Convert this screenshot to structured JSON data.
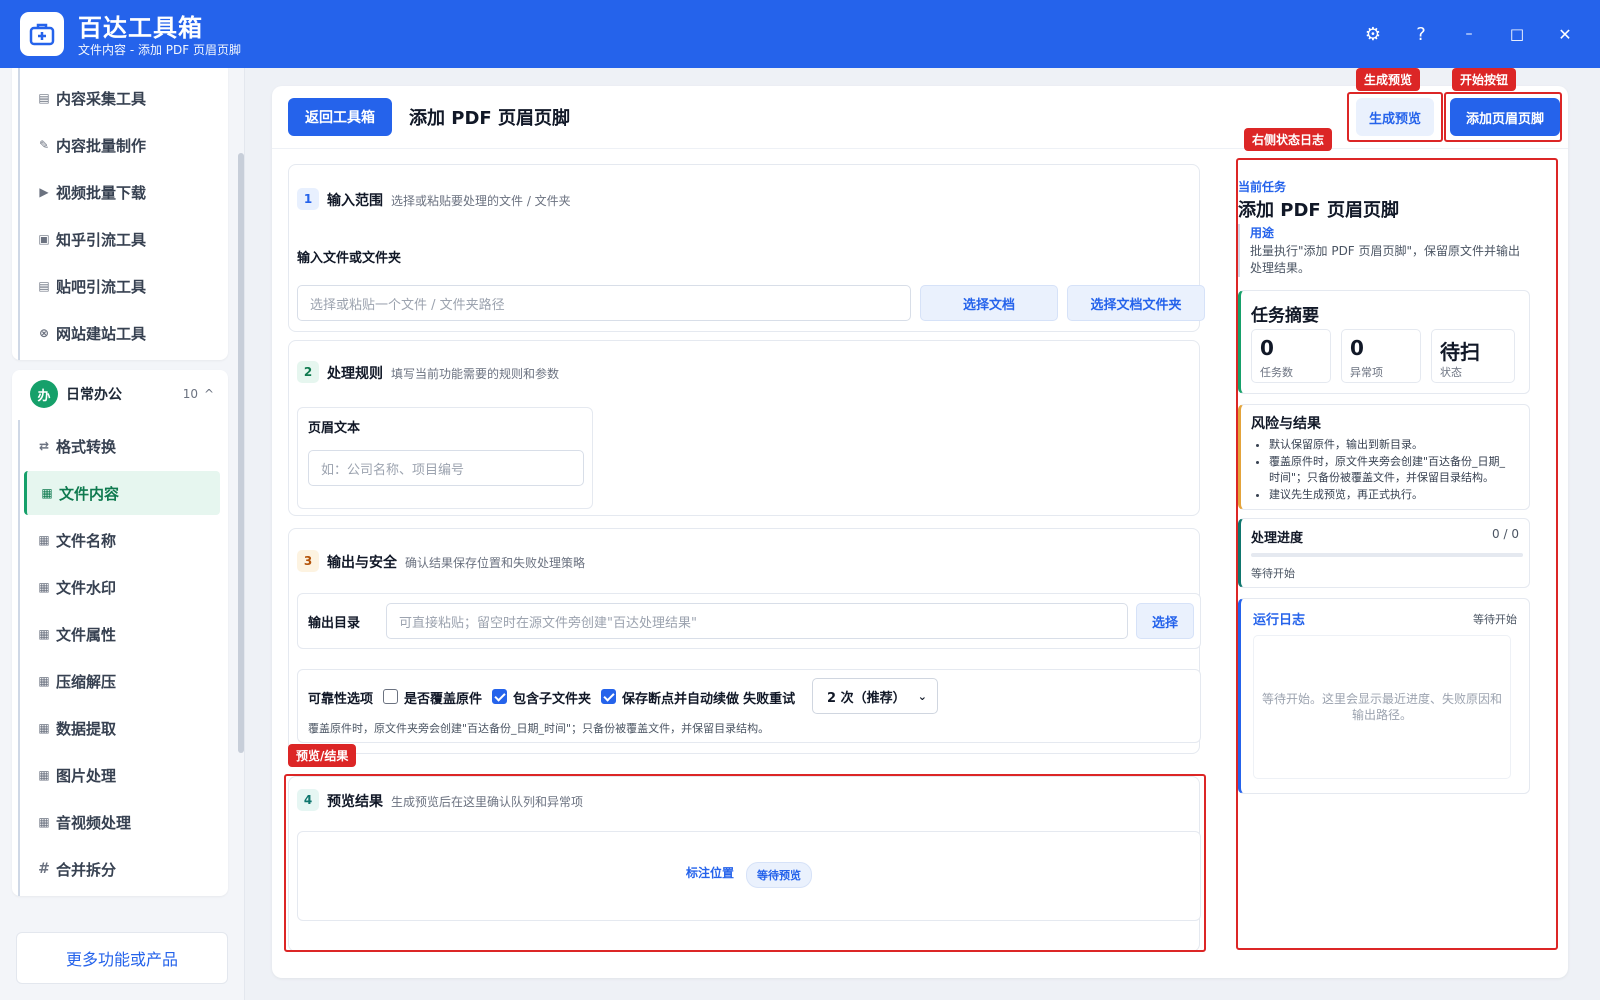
{
  "app": {
    "title": "百达工具箱",
    "subtitle": "文件内容 - 添加 PDF 页眉页脚"
  },
  "window_controls": {
    "settings": "⚙",
    "help": "?",
    "minimize": "–",
    "maximize": "□",
    "close": "✕"
  },
  "sidebar": {
    "top_items": [
      {
        "label": "内容采集工具",
        "icon": "document-icon"
      },
      {
        "label": "内容批量制作",
        "icon": "pen-icon"
      },
      {
        "label": "视频批量下载",
        "icon": "video-icon"
      },
      {
        "label": "知乎引流工具",
        "icon": "zhihu-icon"
      },
      {
        "label": "贴吧引流工具",
        "icon": "forum-icon"
      },
      {
        "label": "网站建站工具",
        "icon": "website-icon"
      }
    ],
    "group": {
      "badge": "办",
      "label": "日常办公",
      "count": "10",
      "caret": "^"
    },
    "group_items": [
      {
        "label": "格式转换",
        "icon": "swap-icon",
        "glyph": "⇄"
      },
      {
        "label": "文件内容",
        "icon": "grid-icon",
        "glyph": "▦",
        "active": true
      },
      {
        "label": "文件名称",
        "icon": "grid-icon",
        "glyph": "▦"
      },
      {
        "label": "文件水印",
        "icon": "grid-icon",
        "glyph": "▦"
      },
      {
        "label": "文件属性",
        "icon": "grid-icon",
        "glyph": "▦"
      },
      {
        "label": "压缩解压",
        "icon": "grid-icon",
        "glyph": "▦"
      },
      {
        "label": "数据提取",
        "icon": "grid-icon",
        "glyph": "▦"
      },
      {
        "label": "图片处理",
        "icon": "grid-icon",
        "glyph": "▦"
      },
      {
        "label": "音视频处理",
        "icon": "grid-icon",
        "glyph": "▦"
      },
      {
        "label": "合并拆分",
        "icon": "hash-icon",
        "glyph": "#"
      }
    ],
    "more_button": "更多功能或产品"
  },
  "header": {
    "back_button": "返回工具箱",
    "title": "添加 PDF 页眉页脚",
    "preview_button": "生成预览",
    "start_button": "添加页眉页脚"
  },
  "annotations": {
    "preview": "生成预览",
    "start": "开始按钮",
    "right_log": "右侧状态日志",
    "preview_result": "预览/结果"
  },
  "section1": {
    "step": "1",
    "title": "输入范围",
    "desc": "选择或粘贴要处理的文件 / 文件夹",
    "field_label": "输入文件或文件夹",
    "input_placeholder": "选择或粘贴一个文件 / 文件夹路径",
    "btn_select_doc": "选择文档",
    "btn_select_folder": "选择文档文件夹"
  },
  "section2": {
    "step": "2",
    "title": "处理规则",
    "desc": "填写当前功能需要的规则和参数",
    "field_label": "页眉文本",
    "input_placeholder": "如：公司名称、项目编号"
  },
  "section3": {
    "step": "3",
    "title": "输出与安全",
    "desc": "确认结果保存位置和失败处理策略",
    "output_label": "输出目录",
    "output_placeholder": "可直接粘贴；留空时在源文件旁创建\"百达处理结果\"",
    "output_button": "选择",
    "reliability_label": "可靠性选项",
    "options": [
      {
        "label": "是否覆盖原件",
        "checked": false
      },
      {
        "label": "包含子文件夹",
        "checked": true
      },
      {
        "label": "保存断点并自动续做",
        "checked": true
      }
    ],
    "retry_label": "失败重试",
    "retry_value": "2 次（推荐）",
    "note": "覆盖原件时，原文件夹旁会创建\"百达备份_日期_时间\"；只备份被覆盖文件，并保留目录结构。"
  },
  "section4": {
    "step": "4",
    "title": "预览结果",
    "desc": "生成预览后在这里确认队列和异常项",
    "link": "标注位置",
    "badge": "等待预览"
  },
  "right_panel": {
    "current_task_label": "当前任务",
    "current_task_title": "添加 PDF 页眉页脚",
    "purpose_label": "用途",
    "purpose_text": "批量执行\"添加 PDF 页眉页脚\"，保留原文件并输出处理结果。",
    "summary_title": "任务摘要",
    "stats": [
      {
        "value": "0",
        "label": "任务数"
      },
      {
        "value": "0",
        "label": "异常项"
      },
      {
        "value": "待扫",
        "label": "状态"
      }
    ],
    "risk_title": "风险与结果",
    "risk_items": [
      "默认保留原件，输出到新目录。",
      "覆盖原件时，原文件夹旁会创建\"百达备份_日期_时间\"；只备份被覆盖文件，并保留目录结构。",
      "建议先生成预览，再正式执行。"
    ],
    "progress_title": "处理进度",
    "progress_count": "0 / 0",
    "progress_fraction": 0,
    "progress_status": "等待开始",
    "log_title": "运行日志",
    "log_status": "等待开始",
    "log_placeholder": "等待开始。这里会显示最近进度、失败原因和输出路径。"
  },
  "colors": {
    "primary": "#2563eb",
    "accent_green": "#16a06a",
    "annotation_red": "#dc2626",
    "warning_amber": "#e3a33a"
  }
}
